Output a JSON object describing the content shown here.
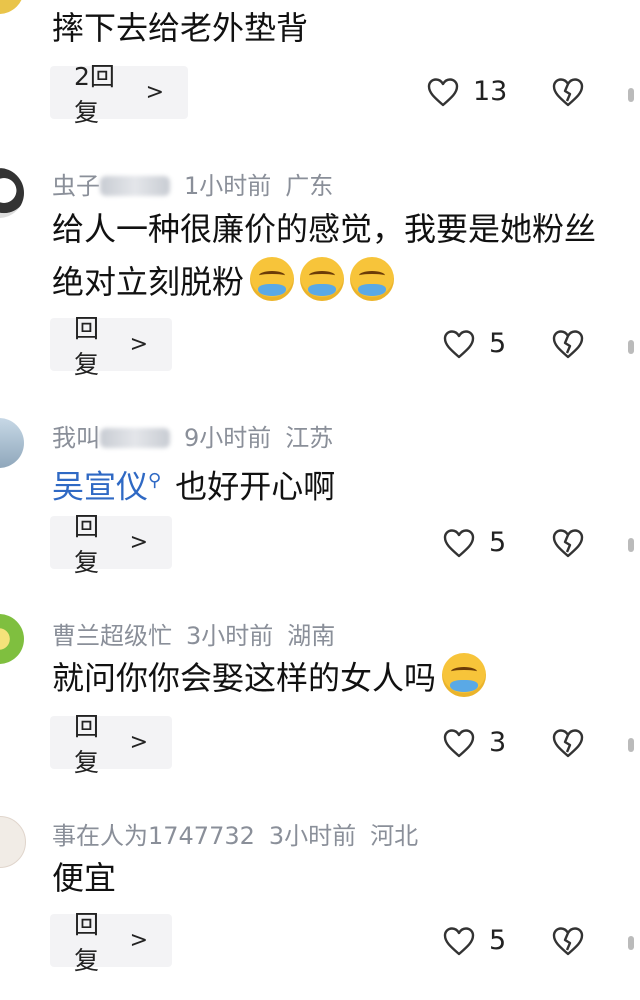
{
  "comments": [
    {
      "content": "摔下去给老外垫背",
      "reply_label": "2回复",
      "likes": "13"
    },
    {
      "nickname": "虫子",
      "time": "1小时前",
      "location": "广东",
      "content": "给人一种很廉价的感觉，我要是她粉丝绝对立刻脱粉",
      "content_line1": "给人一种很廉价的感觉，我要是她粉丝",
      "content_line2": "绝对立刻脱粉",
      "reply_label": "回复",
      "likes": "5"
    },
    {
      "nickname": "我叫",
      "time": "9小时前",
      "location": "江苏",
      "mention": "吴宣仪",
      "content": "也好开心啊",
      "reply_label": "回复",
      "likes": "5"
    },
    {
      "nickname": "曹兰超级忙",
      "time": "3小时前",
      "location": "湖南",
      "content": "就问你你会娶这样的女人吗",
      "reply_label": "回复",
      "likes": "3"
    },
    {
      "nickname": "事在人为1747732",
      "time": "3小时前",
      "location": "河北",
      "content": "便宜",
      "reply_label": "回复",
      "likes": "5"
    }
  ],
  "icons": {
    "like": "heart-outline-icon",
    "dislike": "broken-heart-icon",
    "reply_arrow": "chevron-right-icon",
    "mention": "search-icon"
  }
}
